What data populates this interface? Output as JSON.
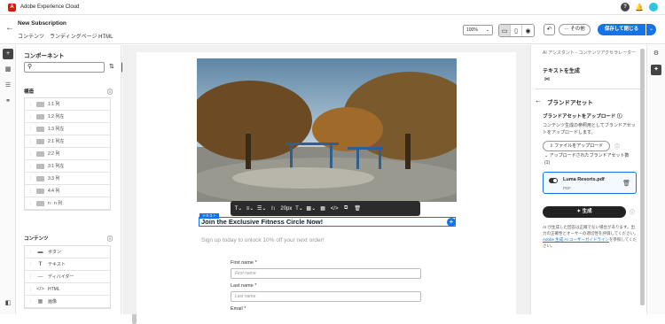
{
  "app": {
    "name": "Adobe Experience Cloud",
    "logo_letter": "A"
  },
  "header": {
    "title": "New Subscription",
    "breadcrumb": [
      "コンテンツ",
      "ランディングページ HTML"
    ],
    "zoom": "100%",
    "more_label": "その他",
    "save_label": "保存して閉じる"
  },
  "left_panel": {
    "title": "コンポーネント",
    "search_placeholder": "",
    "structure_title": "構造",
    "structure_items": [
      "1:1 列",
      "1:2 列左",
      "1:3 列左",
      "2:1 列左",
      "2:2 列",
      "3:1 列左",
      "3:3 列",
      "4:4 列",
      "n : n 列"
    ],
    "content_title": "コンテンツ",
    "content_items": [
      "ボタン",
      "テキスト",
      "ディバイダー",
      "HTML",
      "画像"
    ]
  },
  "canvas": {
    "tag_label": "テキスト",
    "headline": "Join the Exclusive Fitness Circle Now!",
    "subline": "Sign up today to unlock 10% off your next order!",
    "toolbar_size": "20px",
    "fields": [
      {
        "label": "First name",
        "placeholder": "First name"
      },
      {
        "label": "Last name",
        "placeholder": "Last name"
      },
      {
        "label": "Email",
        "placeholder": ""
      }
    ]
  },
  "right_panel": {
    "assistant_title": "AI アシスタント - コンテンツアクセラレーター",
    "generate_text": "テキストを生成",
    "brand_assets_title": "ブランドアセット",
    "upload_heading": "ブランドアセットをアップロード",
    "upload_desc": "コンテンツ生成の参照用としてブランドアセットをアップロードします。",
    "upload_button": "ファイルをアップロード",
    "uploaded_list": "アップロードされたブランドアセット数 (1)",
    "file_name": "Luma Resorts.pdf",
    "file_type": "PDF",
    "generate_button": "生成",
    "disclaimer": "AI が生成した回答は正確でない場合があります。出力の正確性とオーサーの適切性を評価してください。",
    "disclaimer_link": "Adobe 生成 AI ユーザーガイドライン",
    "disclaimer_tail": "を参照してください。"
  },
  "colors": {
    "accent": "#1473e6",
    "brand": "#eb1000"
  }
}
